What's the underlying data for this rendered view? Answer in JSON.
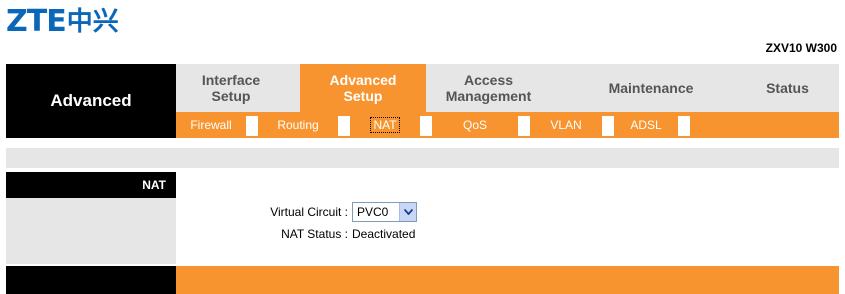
{
  "brand": {
    "logo_latin": "ZTE",
    "logo_cjk": "中兴",
    "model": "ZXV10 W300"
  },
  "left_header": "Advanced",
  "nav": [
    {
      "label": "Interface\nSetup",
      "active": false
    },
    {
      "label": "Advanced\nSetup",
      "active": true
    },
    {
      "label": "Access\nManagement",
      "active": false
    },
    {
      "label": "Maintenance",
      "active": false
    },
    {
      "label": "Status",
      "active": false
    }
  ],
  "subnav": [
    {
      "label": "Firewall",
      "active": false
    },
    {
      "label": "Routing",
      "active": false
    },
    {
      "label": "NAT",
      "active": true
    },
    {
      "label": "QoS",
      "active": false
    },
    {
      "label": "VLAN",
      "active": false
    },
    {
      "label": "ADSL",
      "active": false
    }
  ],
  "section": {
    "title": "NAT"
  },
  "form": {
    "virtual_circuit_label": "Virtual Circuit :",
    "virtual_circuit_value": "PVC0",
    "nat_status_label": "NAT Status :",
    "nat_status_value": "Deactivated"
  },
  "colors": {
    "accent": "#f7942f",
    "logo": "#0b67b8",
    "header_bg": "#000000",
    "gray": "#e6e6e6"
  }
}
